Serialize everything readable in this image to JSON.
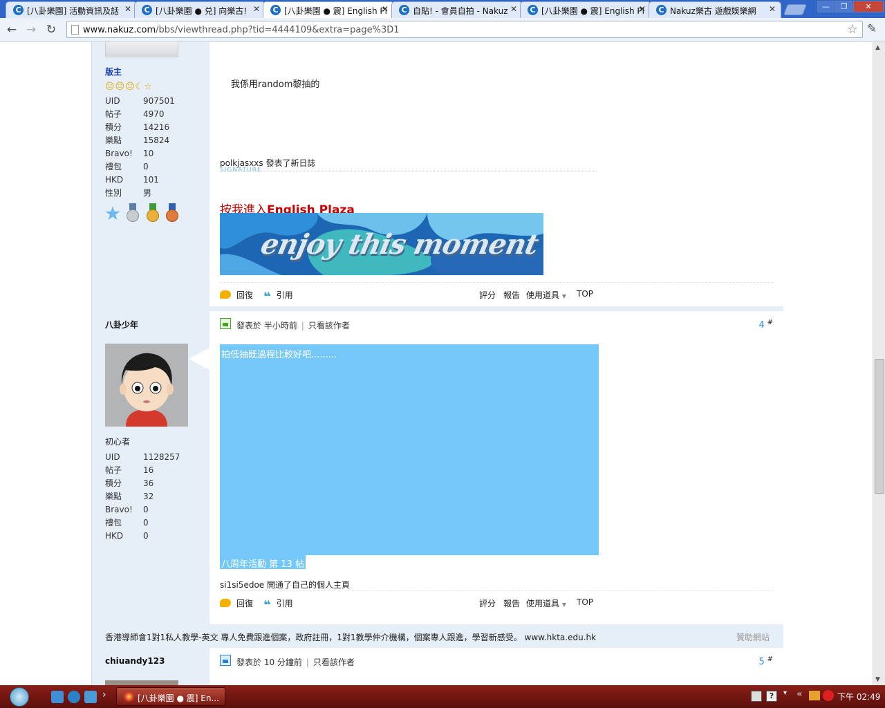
{
  "browser": {
    "tabs": [
      {
        "label": "[八卦樂園] 活動資訊及話"
      },
      {
        "label": "[八卦樂園 ● 兑] 向樂古!"
      },
      {
        "label": "[八卦樂園 ● 震] English Pl"
      },
      {
        "label": "自貼! - 會員自拍 - Nakuz"
      },
      {
        "label": "[八卦樂園 ● 震] English Pl"
      },
      {
        "label": "Nakuz樂古 遊戲娛樂網"
      }
    ],
    "url_host": "www.nakuz.com",
    "url_path": "/bbs/viewthread.php?tid=4444109&extra=page%3D1"
  },
  "post3": {
    "rank": "版主",
    "stars": "😐😐😐☾☆",
    "stats": [
      {
        "k": "UID",
        "v": "907501"
      },
      {
        "k": "帖子",
        "v": "4970"
      },
      {
        "k": "積分",
        "v": "14216"
      },
      {
        "k": "樂點",
        "v": "15824"
      },
      {
        "k": "Bravo!",
        "v": "10"
      },
      {
        "k": "禮包",
        "v": "0"
      },
      {
        "k": "HKD",
        "v": "101"
      },
      {
        "k": "性別",
        "v": "男"
      }
    ],
    "content": "我係用random黎抽的",
    "activity": "polkjasxxs 發表了新日誌",
    "signature_label": "SIGNATURE",
    "sig_link_prefix": "按我進入",
    "sig_link_bold": "English Plaza",
    "banner_text": "enjoy this moment"
  },
  "actions": {
    "reply": "回復",
    "quote": "引用",
    "rate": "評分",
    "report": "報告",
    "tools": "使用道具",
    "top": "TOP"
  },
  "post4": {
    "username": "八卦少年",
    "rank": "初心者",
    "posted": "發表於 半小時前",
    "only_author": "只看該作者",
    "floor": "4",
    "floor_mark": "#",
    "stats": [
      {
        "k": "UID",
        "v": "1128257"
      },
      {
        "k": "帖子",
        "v": "16"
      },
      {
        "k": "積分",
        "v": "36"
      },
      {
        "k": "樂點",
        "v": "32"
      },
      {
        "k": "Bravo!",
        "v": "0"
      },
      {
        "k": "禮包",
        "v": "0"
      },
      {
        "k": "HKD",
        "v": "0"
      }
    ],
    "content_top": "拍低抽既過程比較好吧.........",
    "content_bottom": "八周年活動 第 13 帖",
    "activity": "si1si5edoe 開通了自己的個人主頁"
  },
  "ad": {
    "text": "香港導師會1對1私人教學-英文 專人免費跟進個案，政府註冊，1對1教學仲介機構，個案專人跟進，學習新感受。 www.hktа.edu.hk",
    "sponsor": "贊助網站"
  },
  "post5": {
    "username": "chiuandy123",
    "posted": "發表於 10 分鐘前",
    "only_author": "只看該作者",
    "floor": "5",
    "floor_mark": "#"
  },
  "taskbar": {
    "active_window": "[八卦樂園 ● 震] En...",
    "clock": "下午 02:49"
  },
  "colors": {
    "selection": "#74c8f7",
    "link_red": "#cc0000",
    "moderator_blue": "#1840b0",
    "sidebar_bg": "#e6eef7"
  }
}
